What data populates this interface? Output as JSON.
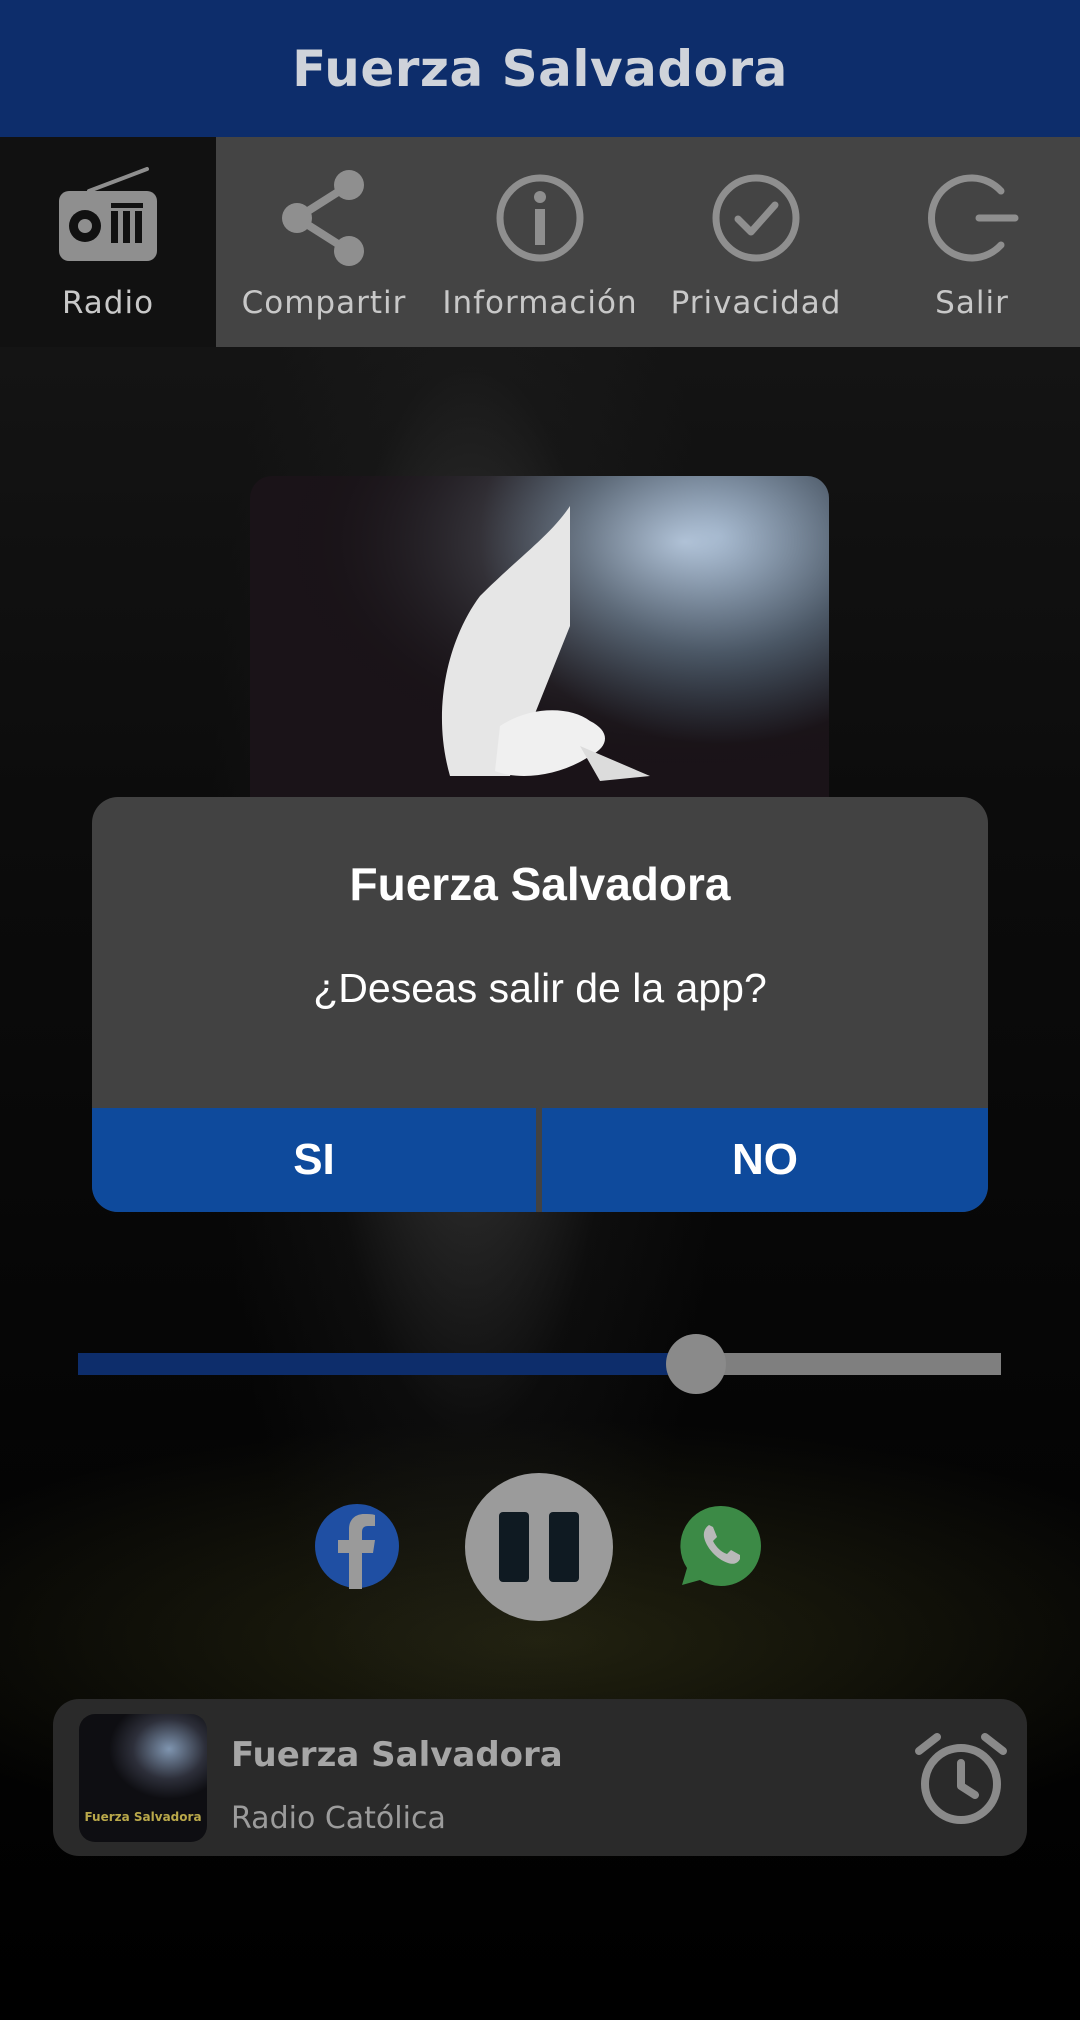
{
  "app": {
    "title": "Fuerza Salvadora"
  },
  "tabs": [
    {
      "label": "Radio",
      "icon": "radio-icon",
      "active": true
    },
    {
      "label": "Compartir",
      "icon": "share-icon",
      "active": false
    },
    {
      "label": "Información",
      "icon": "info-icon",
      "active": false
    },
    {
      "label": "Privacidad",
      "icon": "check-circle-icon",
      "active": false
    },
    {
      "label": "Salir",
      "icon": "power-icon",
      "active": false
    }
  ],
  "player": {
    "volume_fraction": 0.67,
    "station_name": "Fuerza Salvadora",
    "station_subtitle": "Radio Católica",
    "thumb_text": "Fuerza Salvadora"
  },
  "dialog": {
    "title": "Fuerza Salvadora",
    "message": "¿Deseas salir de la app?",
    "yes_label": "SI",
    "no_label": "NO"
  },
  "colors": {
    "topbar": "#0d2d6b",
    "dialog_button": "#0e4a9c",
    "dialog_bg": "#424242"
  }
}
